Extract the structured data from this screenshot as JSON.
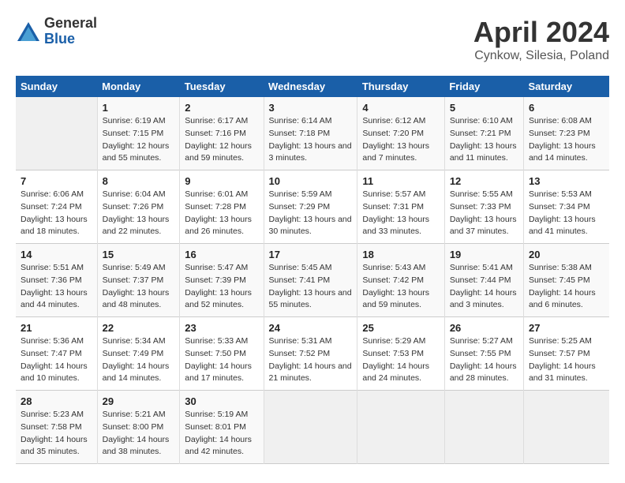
{
  "logo": {
    "general": "General",
    "blue": "Blue"
  },
  "title": "April 2024",
  "subtitle": "Cynkow, Silesia, Poland",
  "days_header": [
    "Sunday",
    "Monday",
    "Tuesday",
    "Wednesday",
    "Thursday",
    "Friday",
    "Saturday"
  ],
  "weeks": [
    [
      {
        "day": "",
        "sunrise": "",
        "sunset": "",
        "daylight": ""
      },
      {
        "day": "1",
        "sunrise": "Sunrise: 6:19 AM",
        "sunset": "Sunset: 7:15 PM",
        "daylight": "Daylight: 12 hours and 55 minutes."
      },
      {
        "day": "2",
        "sunrise": "Sunrise: 6:17 AM",
        "sunset": "Sunset: 7:16 PM",
        "daylight": "Daylight: 12 hours and 59 minutes."
      },
      {
        "day": "3",
        "sunrise": "Sunrise: 6:14 AM",
        "sunset": "Sunset: 7:18 PM",
        "daylight": "Daylight: 13 hours and 3 minutes."
      },
      {
        "day": "4",
        "sunrise": "Sunrise: 6:12 AM",
        "sunset": "Sunset: 7:20 PM",
        "daylight": "Daylight: 13 hours and 7 minutes."
      },
      {
        "day": "5",
        "sunrise": "Sunrise: 6:10 AM",
        "sunset": "Sunset: 7:21 PM",
        "daylight": "Daylight: 13 hours and 11 minutes."
      },
      {
        "day": "6",
        "sunrise": "Sunrise: 6:08 AM",
        "sunset": "Sunset: 7:23 PM",
        "daylight": "Daylight: 13 hours and 14 minutes."
      }
    ],
    [
      {
        "day": "7",
        "sunrise": "Sunrise: 6:06 AM",
        "sunset": "Sunset: 7:24 PM",
        "daylight": "Daylight: 13 hours and 18 minutes."
      },
      {
        "day": "8",
        "sunrise": "Sunrise: 6:04 AM",
        "sunset": "Sunset: 7:26 PM",
        "daylight": "Daylight: 13 hours and 22 minutes."
      },
      {
        "day": "9",
        "sunrise": "Sunrise: 6:01 AM",
        "sunset": "Sunset: 7:28 PM",
        "daylight": "Daylight: 13 hours and 26 minutes."
      },
      {
        "day": "10",
        "sunrise": "Sunrise: 5:59 AM",
        "sunset": "Sunset: 7:29 PM",
        "daylight": "Daylight: 13 hours and 30 minutes."
      },
      {
        "day": "11",
        "sunrise": "Sunrise: 5:57 AM",
        "sunset": "Sunset: 7:31 PM",
        "daylight": "Daylight: 13 hours and 33 minutes."
      },
      {
        "day": "12",
        "sunrise": "Sunrise: 5:55 AM",
        "sunset": "Sunset: 7:33 PM",
        "daylight": "Daylight: 13 hours and 37 minutes."
      },
      {
        "day": "13",
        "sunrise": "Sunrise: 5:53 AM",
        "sunset": "Sunset: 7:34 PM",
        "daylight": "Daylight: 13 hours and 41 minutes."
      }
    ],
    [
      {
        "day": "14",
        "sunrise": "Sunrise: 5:51 AM",
        "sunset": "Sunset: 7:36 PM",
        "daylight": "Daylight: 13 hours and 44 minutes."
      },
      {
        "day": "15",
        "sunrise": "Sunrise: 5:49 AM",
        "sunset": "Sunset: 7:37 PM",
        "daylight": "Daylight: 13 hours and 48 minutes."
      },
      {
        "day": "16",
        "sunrise": "Sunrise: 5:47 AM",
        "sunset": "Sunset: 7:39 PM",
        "daylight": "Daylight: 13 hours and 52 minutes."
      },
      {
        "day": "17",
        "sunrise": "Sunrise: 5:45 AM",
        "sunset": "Sunset: 7:41 PM",
        "daylight": "Daylight: 13 hours and 55 minutes."
      },
      {
        "day": "18",
        "sunrise": "Sunrise: 5:43 AM",
        "sunset": "Sunset: 7:42 PM",
        "daylight": "Daylight: 13 hours and 59 minutes."
      },
      {
        "day": "19",
        "sunrise": "Sunrise: 5:41 AM",
        "sunset": "Sunset: 7:44 PM",
        "daylight": "Daylight: 14 hours and 3 minutes."
      },
      {
        "day": "20",
        "sunrise": "Sunrise: 5:38 AM",
        "sunset": "Sunset: 7:45 PM",
        "daylight": "Daylight: 14 hours and 6 minutes."
      }
    ],
    [
      {
        "day": "21",
        "sunrise": "Sunrise: 5:36 AM",
        "sunset": "Sunset: 7:47 PM",
        "daylight": "Daylight: 14 hours and 10 minutes."
      },
      {
        "day": "22",
        "sunrise": "Sunrise: 5:34 AM",
        "sunset": "Sunset: 7:49 PM",
        "daylight": "Daylight: 14 hours and 14 minutes."
      },
      {
        "day": "23",
        "sunrise": "Sunrise: 5:33 AM",
        "sunset": "Sunset: 7:50 PM",
        "daylight": "Daylight: 14 hours and 17 minutes."
      },
      {
        "day": "24",
        "sunrise": "Sunrise: 5:31 AM",
        "sunset": "Sunset: 7:52 PM",
        "daylight": "Daylight: 14 hours and 21 minutes."
      },
      {
        "day": "25",
        "sunrise": "Sunrise: 5:29 AM",
        "sunset": "Sunset: 7:53 PM",
        "daylight": "Daylight: 14 hours and 24 minutes."
      },
      {
        "day": "26",
        "sunrise": "Sunrise: 5:27 AM",
        "sunset": "Sunset: 7:55 PM",
        "daylight": "Daylight: 14 hours and 28 minutes."
      },
      {
        "day": "27",
        "sunrise": "Sunrise: 5:25 AM",
        "sunset": "Sunset: 7:57 PM",
        "daylight": "Daylight: 14 hours and 31 minutes."
      }
    ],
    [
      {
        "day": "28",
        "sunrise": "Sunrise: 5:23 AM",
        "sunset": "Sunset: 7:58 PM",
        "daylight": "Daylight: 14 hours and 35 minutes."
      },
      {
        "day": "29",
        "sunrise": "Sunrise: 5:21 AM",
        "sunset": "Sunset: 8:00 PM",
        "daylight": "Daylight: 14 hours and 38 minutes."
      },
      {
        "day": "30",
        "sunrise": "Sunrise: 5:19 AM",
        "sunset": "Sunset: 8:01 PM",
        "daylight": "Daylight: 14 hours and 42 minutes."
      },
      {
        "day": "",
        "sunrise": "",
        "sunset": "",
        "daylight": ""
      },
      {
        "day": "",
        "sunrise": "",
        "sunset": "",
        "daylight": ""
      },
      {
        "day": "",
        "sunrise": "",
        "sunset": "",
        "daylight": ""
      },
      {
        "day": "",
        "sunrise": "",
        "sunset": "",
        "daylight": ""
      }
    ]
  ]
}
